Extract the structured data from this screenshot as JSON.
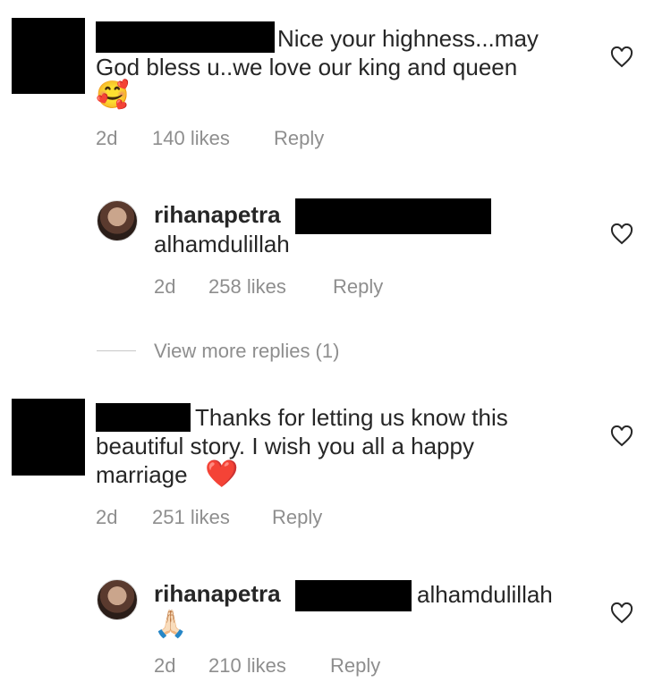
{
  "comments": [
    {
      "text_line1": "Nice your highness...may",
      "text_line2": "God bless u..we love our king and queen",
      "emoji": "🥰",
      "time": "2d",
      "likes": "140 likes",
      "reply": "Reply",
      "replies": [
        {
          "username": "rihanapetra",
          "text": "alhamdulillah",
          "time": "2d",
          "likes": "258 likes",
          "reply": "Reply"
        }
      ],
      "view_more": "View more replies (1)"
    },
    {
      "text_line1": "Thanks for letting us know this",
      "text_line2": "beautiful story. I wish you all a happy",
      "text_line3": "marriage",
      "emoji": "❤️",
      "time": "2d",
      "likes": "251 likes",
      "reply": "Reply",
      "replies": [
        {
          "username": "rihanapetra",
          "text": "alhamdulillah",
          "emoji": "🙏🏻",
          "time": "2d",
          "likes": "210 likes",
          "reply": "Reply"
        }
      ]
    }
  ],
  "icons": {
    "like": "heart-outline-icon"
  },
  "colors": {
    "primary_text": "#262626",
    "secondary_text": "#8e8e8e",
    "redaction": "#000000",
    "heart_heart": "#ed1c24"
  }
}
